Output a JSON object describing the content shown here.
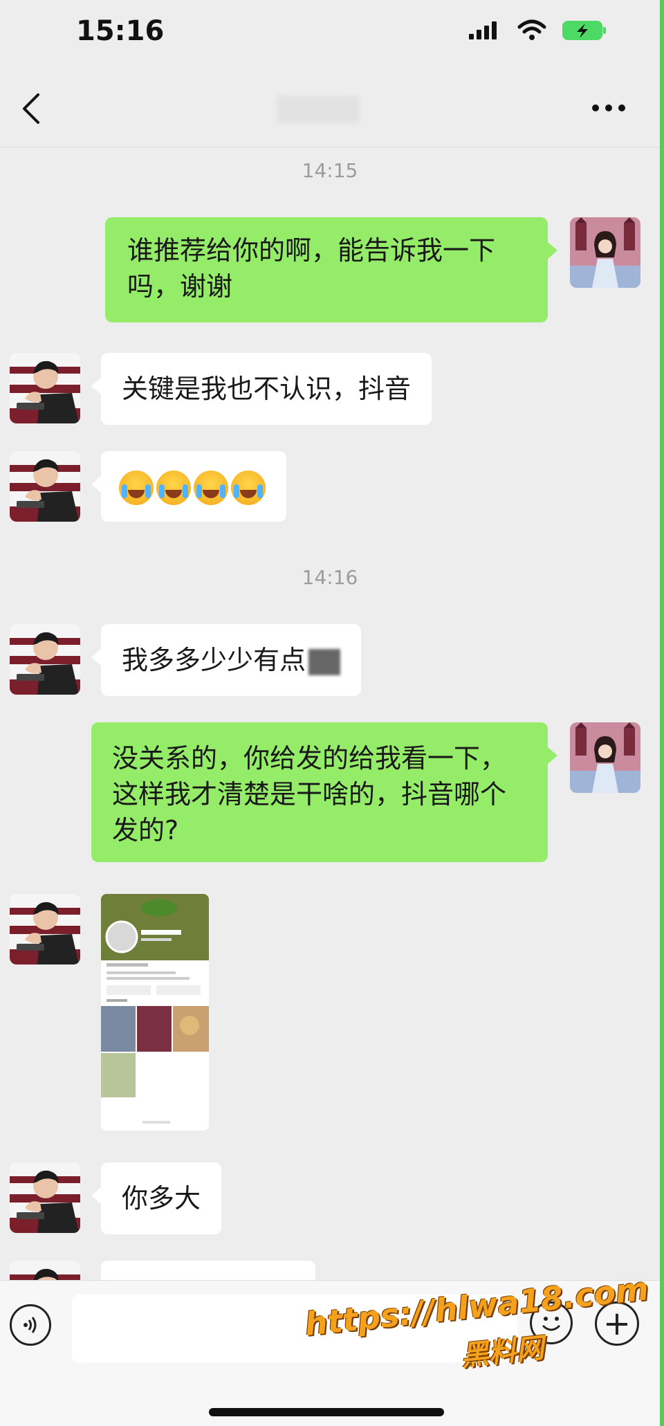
{
  "status_bar": {
    "time": "15:16",
    "icons": [
      "signal-icon",
      "wifi-icon",
      "battery-charging-icon"
    ]
  },
  "header": {
    "back_icon": "chevron-left-icon",
    "more_icon": "more-dots-icon"
  },
  "timestamps": [
    "14:15",
    "14:16"
  ],
  "messages": [
    {
      "side": "out",
      "text": "谁推荐给你的啊，能告诉我一下吗，谢谢"
    },
    {
      "side": "in",
      "text": "关键是我也不认识，抖音"
    },
    {
      "side": "in",
      "type": "emoji",
      "emoji": "laughing-crying-emoji",
      "count": 4
    },
    {
      "side": "in",
      "text": "我多多少少有点"
    },
    {
      "side": "out",
      "text": "没关系的，你给发的给我看一下，这样我才清楚是干啥的，抖音哪个发的?"
    },
    {
      "side": "in",
      "type": "image",
      "image": "profile-screenshot"
    },
    {
      "side": "in",
      "text": "你多大"
    }
  ],
  "input_bar": {
    "voice_icon": "voice-icon",
    "emoji_icon": "emoji-icon",
    "plus_icon": "plus-icon",
    "plus_glyph": "+"
  },
  "watermark": {
    "line1": "https://hlwa18.com",
    "line2": "黑料网"
  },
  "colors": {
    "background": "#ededed",
    "bubble_out": "#95ec69",
    "bubble_in": "#ffffff",
    "accent_edge": "#5cc85a",
    "watermark": "#f4a21d"
  }
}
